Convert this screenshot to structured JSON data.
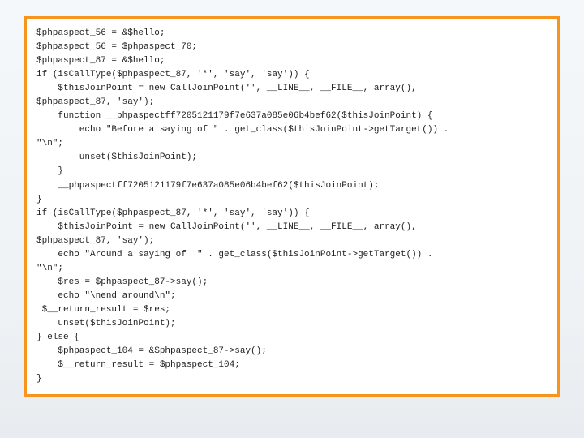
{
  "code": {
    "lines": [
      "$phpaspect_56 = &$hello;",
      "$phpaspect_56 = $phpaspect_70;",
      "$phpaspect_87 = &$hello;",
      "if (isCallType($phpaspect_87, '*', 'say', 'say')) {",
      "    $thisJoinPoint = new CallJoinPoint('', __LINE__, __FILE__, array(),",
      "$phpaspect_87, 'say');",
      "    function __phpaspectff7205121179f7e637a085e06b4bef62($thisJoinPoint) {",
      "        echo \"Before a saying of \" . get_class($thisJoinPoint->getTarget()) .",
      "\"\\n\";",
      "        unset($thisJoinPoint);",
      "    }",
      "    __phpaspectff7205121179f7e637a085e06b4bef62($thisJoinPoint);",
      "}",
      "if (isCallType($phpaspect_87, '*', 'say', 'say')) {",
      "    $thisJoinPoint = new CallJoinPoint('', __LINE__, __FILE__, array(),",
      "$phpaspect_87, 'say');",
      "    echo \"Around a saying of  \" . get_class($thisJoinPoint->getTarget()) .",
      "\"\\n\";",
      "    $res = $phpaspect_87->say();",
      "    echo \"\\nend around\\n\";",
      " $__return_result = $res;",
      "    unset($thisJoinPoint);",
      "} else {",
      "    $phpaspect_104 = &$phpaspect_87->say();",
      "    $__return_result = $phpaspect_104;",
      "}"
    ]
  }
}
